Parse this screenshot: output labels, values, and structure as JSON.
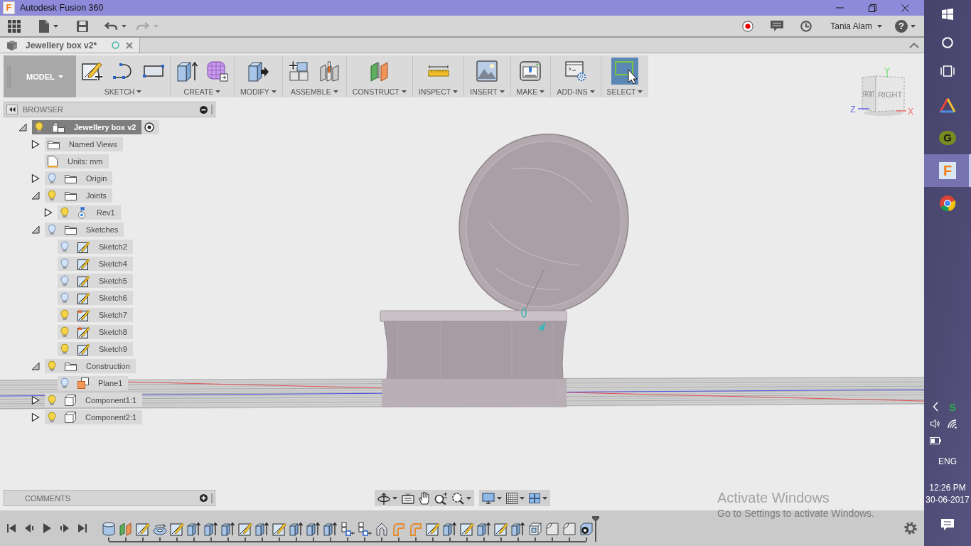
{
  "window": {
    "logo": "F",
    "title": "Autodesk Fusion 360"
  },
  "quick_access": {
    "undo": {
      "disabled": false
    },
    "redo": {
      "disabled": true
    },
    "user": "Tania Alam",
    "help": "?"
  },
  "document_tab": {
    "title": "Jewellery box v2*"
  },
  "ribbon": {
    "workspace": "MODEL",
    "groups": [
      {
        "kind": "sketch",
        "label": "SKETCH",
        "active": false
      },
      {
        "kind": "create",
        "label": "CREATE",
        "active": false
      },
      {
        "kind": "modify",
        "label": "MODIFY",
        "active": false
      },
      {
        "kind": "assemble",
        "label": "ASSEMBLE",
        "active": false
      },
      {
        "kind": "construct",
        "label": "CONSTRUCT",
        "active": false
      },
      {
        "kind": "inspect",
        "label": "INSPECT",
        "active": false
      },
      {
        "kind": "insert",
        "label": "INSERT",
        "active": false
      },
      {
        "kind": "make",
        "label": "MAKE",
        "active": false
      },
      {
        "kind": "addins",
        "label": "ADD-INS",
        "active": false
      },
      {
        "kind": "select",
        "label": "SELECT",
        "active": true
      }
    ]
  },
  "browser": {
    "title": "BROWSER",
    "tree": [
      {
        "kind": "root",
        "label": "Jewellery box v2",
        "expanded": true,
        "visible": true,
        "selected": true,
        "children": [
          {
            "kind": "folder",
            "label": "Named Views",
            "expanded": false,
            "selected": false
          },
          {
            "kind": "units",
            "label": "Units: mm",
            "selected": false
          },
          {
            "kind": "folder",
            "label": "Origin",
            "expanded": false,
            "visible": false,
            "selected": false
          },
          {
            "kind": "folder",
            "label": "Joints",
            "expanded": true,
            "visible": true,
            "selected": false,
            "children": [
              {
                "kind": "joint",
                "label": "Rev1",
                "expanded": false,
                "visible": true,
                "selected": false
              }
            ]
          },
          {
            "kind": "folder",
            "label": "Sketches",
            "expanded": true,
            "visible": false,
            "selected": false,
            "children": [
              {
                "kind": "sketch",
                "label": "Sketch2",
                "visible": false,
                "warning": false,
                "selected": false
              },
              {
                "kind": "sketch",
                "label": "Sketch4",
                "visible": false,
                "warning": false,
                "selected": false
              },
              {
                "kind": "sketch",
                "label": "Sketch5",
                "visible": false,
                "warning": false,
                "selected": false
              },
              {
                "kind": "sketch",
                "label": "Sketch6",
                "visible": false,
                "warning": false,
                "selected": false
              },
              {
                "kind": "sketch",
                "label": "Sketch7",
                "visible": true,
                "warning": true,
                "selected": false
              },
              {
                "kind": "sketch",
                "label": "Sketch8",
                "visible": true,
                "warning": true,
                "selected": false
              },
              {
                "kind": "sketch",
                "label": "Sketch9",
                "visible": true,
                "warning": false,
                "selected": false
              }
            ]
          },
          {
            "kind": "folder",
            "label": "Construction",
            "expanded": true,
            "visible": true,
            "selected": false,
            "children": [
              {
                "kind": "plane",
                "label": "Plane1",
                "visible": false,
                "selected": false
              }
            ]
          },
          {
            "kind": "component",
            "label": "Component1:1",
            "expanded": false,
            "visible": true,
            "selected": false
          },
          {
            "kind": "component",
            "label": "Component2:1",
            "expanded": false,
            "visible": true,
            "selected": false
          }
        ]
      }
    ]
  },
  "view_cube": {
    "faces": [
      {
        "label": "FRONT"
      },
      {
        "label": "RIGHT"
      }
    ],
    "axes": [
      {
        "label": "Y",
        "color": "#66d966"
      },
      {
        "label": "Z",
        "color": "#6a6aee"
      },
      {
        "label": "X",
        "color": "#ee6a6a"
      }
    ]
  },
  "comments": {
    "title": "COMMENTS"
  },
  "timeline": {
    "features": [
      {
        "kind": "body"
      },
      {
        "kind": "plane"
      },
      {
        "kind": "sketch"
      },
      {
        "kind": "revolve"
      },
      {
        "kind": "sketch"
      },
      {
        "kind": "extrude"
      },
      {
        "kind": "extrude"
      },
      {
        "kind": "extrude"
      },
      {
        "kind": "sketch"
      },
      {
        "kind": "extrude"
      },
      {
        "kind": "sketch"
      },
      {
        "kind": "extrude"
      },
      {
        "kind": "extrude"
      },
      {
        "kind": "extrude"
      },
      {
        "kind": "move"
      },
      {
        "kind": "move"
      },
      {
        "kind": "arch"
      },
      {
        "kind": "fillet"
      },
      {
        "kind": "fillet"
      },
      {
        "kind": "sketch"
      },
      {
        "kind": "extrude"
      },
      {
        "kind": "sketch"
      },
      {
        "kind": "extrude"
      },
      {
        "kind": "sketch"
      },
      {
        "kind": "extrude"
      },
      {
        "kind": "shell"
      },
      {
        "kind": "chamfer"
      },
      {
        "kind": "chamfer"
      },
      {
        "kind": "joint"
      }
    ]
  },
  "activation_notice": {
    "title": "Activate Windows",
    "message": "Go to Settings to activate Windows."
  },
  "taskbar": {
    "apps": [
      {
        "kind": "triangle",
        "selected": false
      },
      {
        "kind": "badge",
        "letter": "G",
        "selected": false
      },
      {
        "kind": "logo",
        "letter": "F",
        "selected": true
      },
      {
        "kind": "browser",
        "selected": false
      }
    ],
    "tray": {
      "app_letter": "S",
      "language": "ENG",
      "time": "12:26 PM",
      "date": "30-06-2017"
    }
  }
}
